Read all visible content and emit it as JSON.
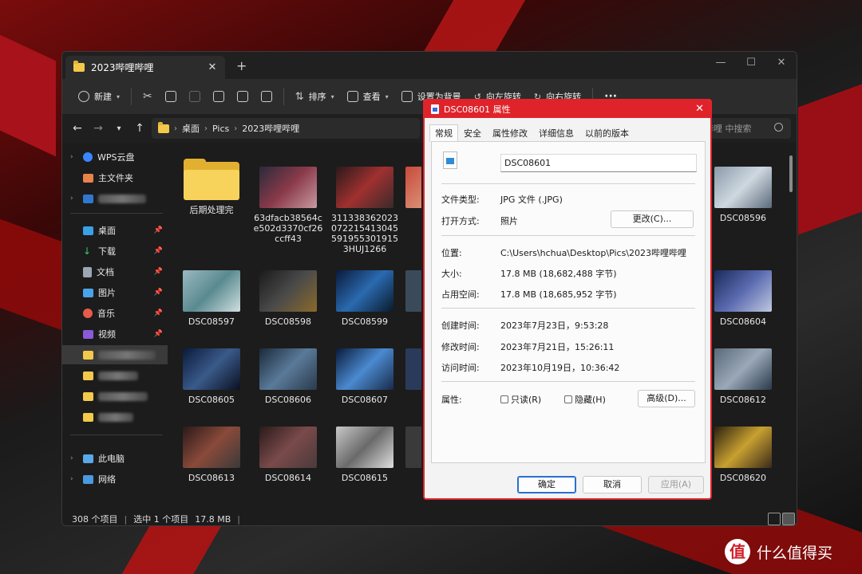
{
  "explorer": {
    "tab_title": "2023哔哩哔哩",
    "new_tab": "+",
    "window_controls": {
      "minimize": "—",
      "maximize": "☐",
      "close": "✕"
    },
    "toolbar": {
      "new_label": "新建",
      "sort_label": "排序",
      "view_label": "查看",
      "set_bg_label": "设置为背景",
      "rotate_left_label": "向左旋转",
      "rotate_right_label": "向右旋转",
      "more_label": "···"
    },
    "address": {
      "parts": [
        "桌面",
        "Pics",
        "2023哔哩哔哩"
      ]
    },
    "search_placeholder": "哔哩 中搜索",
    "sidebar": {
      "wps": "WPS云盘",
      "home": "主文件夹",
      "desktop": "桌面",
      "downloads": "下载",
      "documents": "文档",
      "pictures": "图片",
      "music": "音乐",
      "videos": "视频",
      "this_pc": "此电脑",
      "network": "网络"
    },
    "files": [
      {
        "name": "后期处理完",
        "kind": "folder"
      },
      {
        "name": "63dfacb38564ce502d3370cf26ccff43",
        "kind": "image",
        "color": "#6b4a4a"
      },
      {
        "name": "3113383620230722154130455919553019153HUJ1266",
        "kind": "image",
        "color": "#7a3a3a"
      },
      {
        "name": "DSC08596",
        "kind": "image",
        "color": "#6f7f8f"
      },
      {
        "name": "DSC08597",
        "kind": "image",
        "color": "#5f8a9a"
      },
      {
        "name": "DSC08598",
        "kind": "image",
        "color": "#3a3a3a"
      },
      {
        "name": "DSC08599",
        "kind": "image",
        "color": "#1f3f6a"
      },
      {
        "name": "DSC08604",
        "kind": "image",
        "color": "#2a3a6a"
      },
      {
        "name": "DSC08605",
        "kind": "image",
        "color": "#1a2a4a"
      },
      {
        "name": "DSC08606",
        "kind": "image",
        "color": "#2a3a4a"
      },
      {
        "name": "DSC08607",
        "kind": "image",
        "color": "#20304a"
      },
      {
        "name": "DSC08612",
        "kind": "image",
        "color": "#3a4a5a"
      },
      {
        "name": "DSC08613",
        "kind": "image",
        "color": "#3a2a2a"
      },
      {
        "name": "DSC08614",
        "kind": "image",
        "color": "#3a3030"
      },
      {
        "name": "DSC08615",
        "kind": "image",
        "color": "#6a6a6a"
      },
      {
        "name": "DSC08620",
        "kind": "image",
        "color": "#3a3020"
      }
    ],
    "status": {
      "count": "308 个项目",
      "selected": "选中 1 个项目",
      "size": "17.8 MB"
    }
  },
  "dialog": {
    "title": "DSC08601 属性",
    "tabs": [
      "常规",
      "安全",
      "属性修改",
      "详细信息",
      "以前的版本"
    ],
    "filename": "DSC08601",
    "labels": {
      "file_type": "文件类型:",
      "open_with": "打开方式:",
      "location": "位置:",
      "size": "大小:",
      "size_on_disk": "占用空间:",
      "created": "创建时间:",
      "modified": "修改时间:",
      "accessed": "访问时间:",
      "attributes": "属性:"
    },
    "values": {
      "file_type": "JPG 文件 (.JPG)",
      "open_with": "照片",
      "location": "C:\\Users\\hchua\\Desktop\\Pics\\2023哔哩哔哩",
      "size": "17.8 MB (18,682,488 字节)",
      "size_on_disk": "17.8 MB (18,685,952 字节)",
      "created": "2023年7月23日，9:53:28",
      "modified": "2023年7月21日，15:26:11",
      "accessed": "2023年10月19日，10:36:42"
    },
    "buttons": {
      "change": "更改(C)...",
      "advanced": "高级(D)...",
      "ok": "确定",
      "cancel": "取消",
      "apply": "应用(A)"
    },
    "checkboxes": {
      "readonly": "只读(R)",
      "hidden": "隐藏(H)"
    },
    "accent": "#e0232b"
  },
  "watermark": {
    "logo": "值",
    "text": "什么值得买"
  }
}
